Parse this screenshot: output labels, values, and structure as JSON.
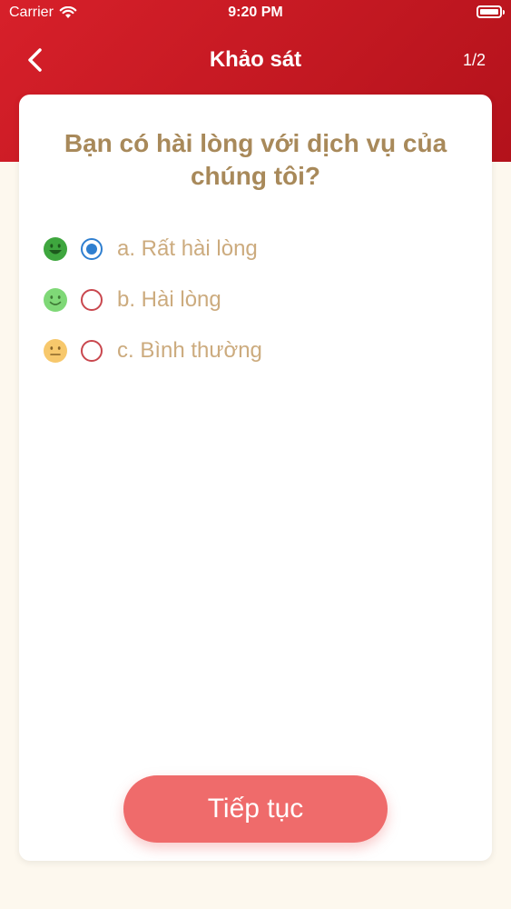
{
  "status_bar": {
    "carrier": "Carrier",
    "time": "9:20 PM"
  },
  "nav": {
    "title": "Khảo sát",
    "page_counter": "1/2"
  },
  "question": "Bạn có hài lòng với dịch vụ của chúng tôi?",
  "options": [
    {
      "label": "a. Rất hài lòng",
      "emoji": "grinning-face-icon",
      "selected": true
    },
    {
      "label": "b. Hài lòng",
      "emoji": "slightly-smiling-face-icon",
      "selected": false
    },
    {
      "label": "c. Bình thường",
      "emoji": "neutral-face-icon",
      "selected": false
    }
  ],
  "continue_button": "Tiếp tục",
  "colors": {
    "header": "#c8161f",
    "question_text": "#a8895a",
    "option_text": "#ccab7e",
    "radio_selected": "#2f7fd0",
    "radio_unselected": "#c9474e",
    "button": "#ef6b6b"
  }
}
